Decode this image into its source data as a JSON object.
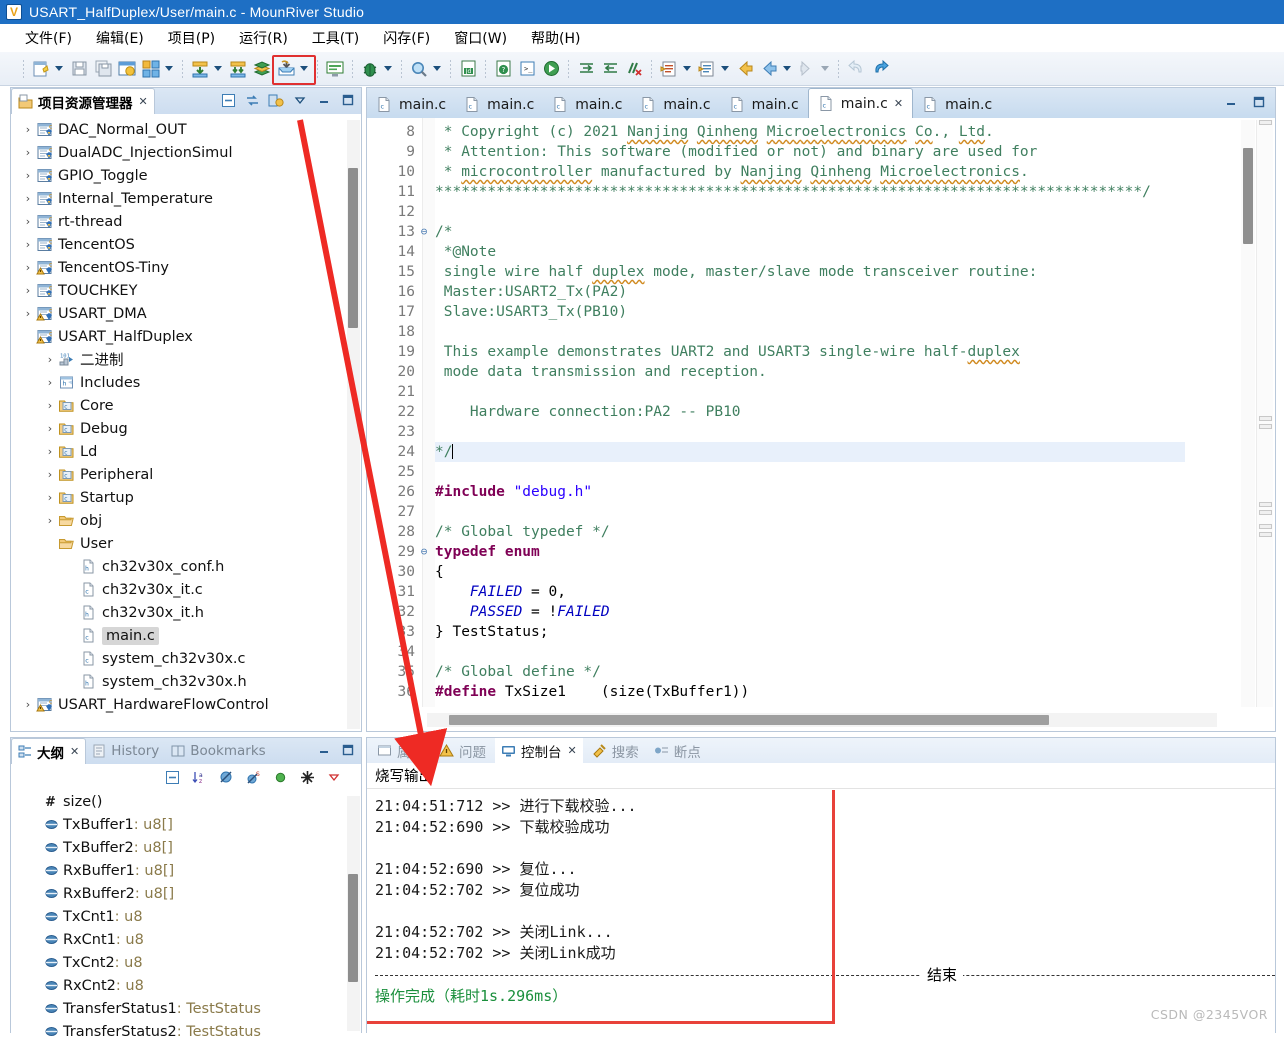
{
  "window": {
    "title": "USART_HalfDuplex/User/main.c - MounRiver Studio",
    "app_icon": "mounriver-logo-icon",
    "minimize_label": "–",
    "restore_label": "❐"
  },
  "menubar": {
    "items": [
      {
        "label": "文件(F)",
        "name": "menu-file"
      },
      {
        "label": "编辑(E)",
        "name": "menu-edit"
      },
      {
        "label": "项目(P)",
        "name": "menu-project"
      },
      {
        "label": "运行(R)",
        "name": "menu-run"
      },
      {
        "label": "工具(T)",
        "name": "menu-tools"
      },
      {
        "label": "闪存(F)",
        "name": "menu-flash"
      },
      {
        "label": "窗口(W)",
        "name": "menu-window"
      },
      {
        "label": "帮助(H)",
        "name": "menu-help"
      }
    ]
  },
  "toolbar": {
    "highlighted_button": "download-flash-button",
    "buttons": [
      "new-file-icon",
      "new-file-dropdown",
      "save-icon",
      "save-all-icon",
      "build-config-icon",
      "build-project-icon",
      "build-dropdown",
      "download-icon",
      "download-dropdown",
      "download-all-icon",
      "library-icon",
      "download-flash-icon",
      "download-flash-dropdown",
      "terminal-icon",
      "debug-icon",
      "debug-dropdown",
      "search-icon",
      "search-dropdown",
      "javadoc-icon",
      "help-icon",
      "console-icon",
      "resume-icon",
      "next-edit-icon",
      "prev-edit-icon",
      "clear-markers-icon",
      "open-declaration-icon",
      "open-declaration-dropdown",
      "open-type-icon",
      "open-type-dropdown",
      "back-icon",
      "forward-icon",
      "forward-dropdown",
      "next-annotation-icon",
      "next-annotation-dropdown",
      "undo-icon",
      "redo-icon"
    ]
  },
  "project_explorer": {
    "tab_label": "项目资源管理器",
    "tab_close": "✕",
    "tools": [
      "collapse-all-icon",
      "link-with-editor-icon",
      "view-menu-icon",
      "view-dropdown-icon",
      "minimize-icon",
      "maximize-icon"
    ],
    "items": [
      {
        "label": "DAC_Normal_OUT",
        "indent": 0,
        "arrow": "›",
        "icon": "c-project-icon"
      },
      {
        "label": "DualADC_InjectionSimul",
        "indent": 0,
        "arrow": "›",
        "icon": "c-project-icon"
      },
      {
        "label": "GPIO_Toggle",
        "indent": 0,
        "arrow": "›",
        "icon": "c-project-icon"
      },
      {
        "label": "Internal_Temperature",
        "indent": 0,
        "arrow": "›",
        "icon": "c-project-icon"
      },
      {
        "label": "rt-thread",
        "indent": 0,
        "arrow": "›",
        "icon": "c-project-icon"
      },
      {
        "label": "TencentOS",
        "indent": 0,
        "arrow": "›",
        "icon": "c-project-icon"
      },
      {
        "label": "TencentOS-Tiny",
        "indent": 0,
        "arrow": "›",
        "icon": "c-project-warn-icon"
      },
      {
        "label": "TOUCHKEY",
        "indent": 0,
        "arrow": "›",
        "icon": "c-project-icon"
      },
      {
        "label": "USART_DMA",
        "indent": 0,
        "arrow": "›",
        "icon": "c-project-warn-icon"
      },
      {
        "label": "USART_HalfDuplex",
        "indent": 0,
        "arrow": "ⱟ",
        "icon": "c-project-warn-icon"
      },
      {
        "label": "二进制",
        "indent": 1,
        "arrow": "›",
        "icon": "binaries-icon"
      },
      {
        "label": "Includes",
        "indent": 1,
        "arrow": "›",
        "icon": "includes-icon"
      },
      {
        "label": "Core",
        "indent": 1,
        "arrow": "›",
        "icon": "source-folder-icon"
      },
      {
        "label": "Debug",
        "indent": 1,
        "arrow": "›",
        "icon": "source-folder-icon"
      },
      {
        "label": "Ld",
        "indent": 1,
        "arrow": "›",
        "icon": "source-folder-icon"
      },
      {
        "label": "Peripheral",
        "indent": 1,
        "arrow": "›",
        "icon": "source-folder-icon"
      },
      {
        "label": "Startup",
        "indent": 1,
        "arrow": "›",
        "icon": "source-folder-icon"
      },
      {
        "label": "obj",
        "indent": 1,
        "arrow": "›",
        "icon": "folder-icon"
      },
      {
        "label": "User",
        "indent": 1,
        "arrow": "ⱟ",
        "icon": "folder-icon"
      },
      {
        "label": "ch32v30x_conf.h",
        "indent": 2,
        "arrow": "",
        "icon": "h-file-icon"
      },
      {
        "label": "ch32v30x_it.c",
        "indent": 2,
        "arrow": "",
        "icon": "c-file-icon"
      },
      {
        "label": "ch32v30x_it.h",
        "indent": 2,
        "arrow": "",
        "icon": "h-file-icon"
      },
      {
        "label": "main.c",
        "indent": 2,
        "arrow": "",
        "icon": "c-file-icon",
        "selected": true
      },
      {
        "label": "system_ch32v30x.c",
        "indent": 2,
        "arrow": "",
        "icon": "c-file-icon"
      },
      {
        "label": "system_ch32v30x.h",
        "indent": 2,
        "arrow": "",
        "icon": "h-file-icon"
      },
      {
        "label": "USART_HardwareFlowControl",
        "indent": 0,
        "arrow": "›",
        "icon": "c-project-warn-icon"
      }
    ]
  },
  "editor": {
    "tabs": [
      {
        "label": "main.c",
        "active": false
      },
      {
        "label": "main.c",
        "active": false
      },
      {
        "label": "main.c",
        "active": false
      },
      {
        "label": "main.c",
        "active": false
      },
      {
        "label": "main.c",
        "active": false
      },
      {
        "label": "main.c",
        "active": true,
        "close": "✕"
      },
      {
        "label": "main.c",
        "active": false
      }
    ],
    "tools": [
      "minimize-icon",
      "maximize-icon"
    ],
    "lines": [
      {
        "n": "8",
        "fold": "",
        "html": "<span class='cm'> * Copyright (c) 2021 <span class='sq'>Nanjing</span> <span class='sq'>Qinheng</span> <span class='sq'>Microelectronics</span> <span class='sq'>Co</span>., <span class='sq'>Ltd</span>.</span>"
      },
      {
        "n": "9",
        "fold": "",
        "html": "<span class='cm'> * Attention: This software (modified or not) and binary are used for</span>"
      },
      {
        "n": "10",
        "fold": "",
        "html": "<span class='cm'> * <span class='sq'>microcontroller</span> manufactured by <span class='sq'>Nanjing</span> <span class='sq'>Qinheng</span> <span class='sq'>Microelectronics</span>.</span>"
      },
      {
        "n": "11",
        "fold": "",
        "html": "<span class='cm'>*********************************************************************************/</span>"
      },
      {
        "n": "12",
        "fold": "",
        "html": ""
      },
      {
        "n": "13",
        "fold": "⊖",
        "html": "<span class='cm'>/*</span>"
      },
      {
        "n": "14",
        "fold": "",
        "html": "<span class='cm'> *@Note</span>"
      },
      {
        "n": "15",
        "fold": "",
        "html": "<span class='cm'> single wire half <span class='sq'>duplex</span> mode, master/slave mode transceiver routine:</span>"
      },
      {
        "n": "16",
        "fold": "",
        "html": "<span class='cm'> Master:USART2_Tx(PA2)</span>"
      },
      {
        "n": "17",
        "fold": "",
        "html": "<span class='cm'> Slave:USART3_Tx(PB10)</span>"
      },
      {
        "n": "18",
        "fold": "",
        "html": ""
      },
      {
        "n": "19",
        "fold": "",
        "html": "<span class='cm'> This example demonstrates UART2 and USART3 single-wire half-<span class='sq'>duplex</span></span>"
      },
      {
        "n": "20",
        "fold": "",
        "html": "<span class='cm'> mode data transmission and reception.</span>"
      },
      {
        "n": "21",
        "fold": "",
        "html": ""
      },
      {
        "n": "22",
        "fold": "",
        "html": "<span class='cm'>    Hardware connection:PA2 -- PB10</span>"
      },
      {
        "n": "23",
        "fold": "",
        "html": ""
      },
      {
        "n": "24",
        "fold": "",
        "html": "<span class='cm'>*/</span><span class='caret-bar'></span>",
        "highlight": true
      },
      {
        "n": "25",
        "fold": "",
        "html": ""
      },
      {
        "n": "26",
        "fold": "",
        "html": "<span class='pp'>#include</span> <span class='str'>\"debug.h\"</span>"
      },
      {
        "n": "27",
        "fold": "",
        "html": ""
      },
      {
        "n": "28",
        "fold": "",
        "html": "<span class='cm'>/* Global typedef */</span>"
      },
      {
        "n": "29",
        "fold": "⊖",
        "html": "<span class='kw'>typedef enum</span>"
      },
      {
        "n": "30",
        "fold": "",
        "html": "{"
      },
      {
        "n": "31",
        "fold": "",
        "html": "    <span class='en'>FAILED</span> = 0,"
      },
      {
        "n": "32",
        "fold": "",
        "html": "    <span class='en'>PASSED</span> = !<span class='en'>FAILED</span>"
      },
      {
        "n": "33",
        "fold": "",
        "html": "} TestStatus;"
      },
      {
        "n": "34",
        "fold": "",
        "html": ""
      },
      {
        "n": "35",
        "fold": "",
        "html": "<span class='cm'>/* Global define */</span>"
      },
      {
        "n": "36",
        "fold": "",
        "html": "<span class='pp'>#define</span> TxSize1    (size(TxBuffer1))"
      }
    ]
  },
  "outline": {
    "tabs": [
      {
        "label": "大纲",
        "active": true,
        "icon": "outline-icon",
        "close": "✕"
      },
      {
        "label": "History",
        "active": false,
        "icon": "history-icon"
      },
      {
        "label": "Bookmarks",
        "active": false,
        "icon": "bookmarks-icon"
      }
    ],
    "tools": [
      "collapse-all-icon",
      "sort-icon",
      "hide-fields-icon",
      "hide-static-icon",
      "hide-nonpublic-icon",
      "filters-icon",
      "view-menu-icon"
    ],
    "items": [
      {
        "icon": "macro-icon",
        "name": "size()",
        "type": ""
      },
      {
        "icon": "field-icon",
        "name": "TxBuffer1",
        "type": " : u8[]"
      },
      {
        "icon": "field-icon",
        "name": "TxBuffer2",
        "type": " : u8[]"
      },
      {
        "icon": "field-icon",
        "name": "RxBuffer1",
        "type": " : u8[]"
      },
      {
        "icon": "field-icon",
        "name": "RxBuffer2",
        "type": " : u8[]"
      },
      {
        "icon": "field-icon",
        "name": "TxCnt1",
        "type": " : u8"
      },
      {
        "icon": "field-icon",
        "name": "RxCnt1",
        "type": " : u8"
      },
      {
        "icon": "field-icon",
        "name": "TxCnt2",
        "type": " : u8"
      },
      {
        "icon": "field-icon",
        "name": "RxCnt2",
        "type": " : u8"
      },
      {
        "icon": "field-icon",
        "name": "TransferStatus1",
        "type": " : TestStatus"
      },
      {
        "icon": "field-icon",
        "name": "TransferStatus2",
        "type": " : TestStatus"
      }
    ]
  },
  "console": {
    "tabs": [
      {
        "label": "属性",
        "active": false,
        "icon": "properties-icon"
      },
      {
        "label": "问题",
        "active": false,
        "icon": "problems-icon"
      },
      {
        "label": "控制台",
        "active": true,
        "icon": "console-icon",
        "close": "✕"
      },
      {
        "label": "搜索",
        "active": false,
        "icon": "search-icon"
      },
      {
        "label": "断点",
        "active": false,
        "icon": "breakpoints-icon"
      }
    ],
    "header": "烧写输出",
    "lines": [
      {
        "text": "21:04:51:712 >> 进行下载校验...",
        "kind": "normal"
      },
      {
        "text": "21:04:52:690 >> 下载校验成功",
        "kind": "normal"
      },
      {
        "text": "",
        "kind": "blank"
      },
      {
        "text": "21:04:52:690 >> 复位...",
        "kind": "normal"
      },
      {
        "text": "21:04:52:702 >> 复位成功",
        "kind": "normal"
      },
      {
        "text": "",
        "kind": "blank"
      },
      {
        "text": "21:04:52:702 >> 关闭Link...",
        "kind": "normal"
      },
      {
        "text": "21:04:52:702 >> 关闭Link成功",
        "kind": "normal"
      }
    ],
    "separator_label": "结束",
    "result": "操作完成（耗时1s.296ms）"
  },
  "annotation": {
    "arrow_color": "#ee2a24",
    "box_color": "#e8413a"
  },
  "watermark": "CSDN @2345VOR"
}
